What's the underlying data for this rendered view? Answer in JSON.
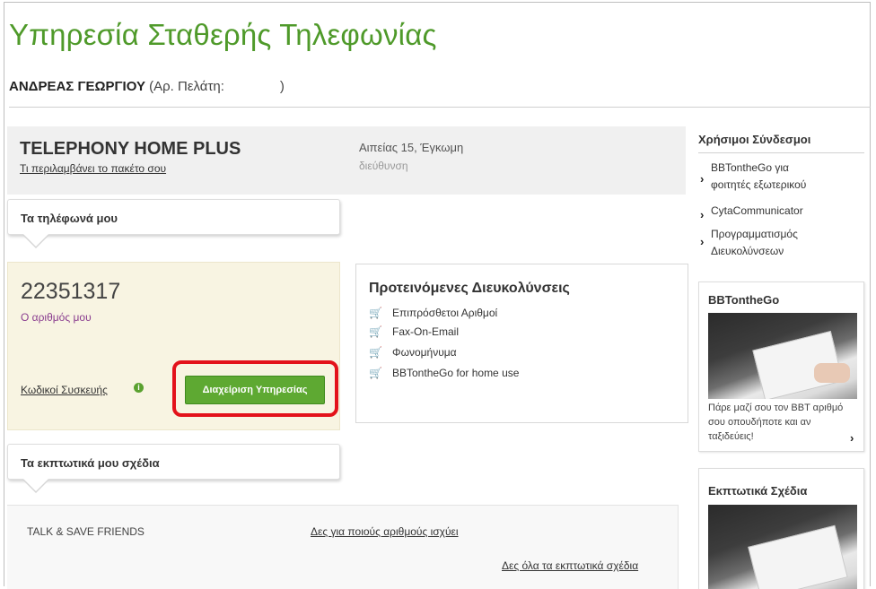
{
  "page": {
    "title": "Υπηρεσία Σταθερής Τηλεφωνίας",
    "customer_name": "ΑΝΔΡΕΑΣ ΓΕΩΡΓΙΟΥ",
    "customer_number_label": "(Αρ. Πελάτη:",
    "customer_number_close": ")"
  },
  "package": {
    "name": "TELEPHONY HOME PLUS",
    "includes_link": "Τι περιλαμβάνει το πακέτο σου",
    "address": "Αιπείας 15, Έγκωμη",
    "address_label": "διεύθυνση"
  },
  "phones": {
    "section_title": "Τα τηλέφωνά μου",
    "number": "22351317",
    "number_label": "Ο αριθμός μου",
    "device_codes_link": "Κωδικοί Συσκευής",
    "manage_button": "Διαχείριση Υπηρεσίας"
  },
  "features": {
    "title": "Προτεινόμενες Διευκολύνσεις",
    "items": [
      "Επιπρόσθετοι Αριθμοί",
      "Fax-On-Email",
      "Φωνομήνυμα",
      "BBTontheGo for home use"
    ]
  },
  "plans": {
    "section_title": "Τα εκπτωτικά μου σχέδια",
    "plan_name": "TALK & SAVE FRIENDS",
    "plan_numbers_link": "Δες για ποιούς αριθμούς ισχύει",
    "all_plans_link": "Δες όλα τα εκπτωτικά σχέδια"
  },
  "sidebar": {
    "useful_links_title": "Χρήσιμοι Σύνδεσμοι",
    "links": [
      {
        "line1": "BBTontheGo για",
        "line2": "φοιτητές εξωτερικού"
      },
      {
        "line1": "CytaCommunicator",
        "line2": ""
      },
      {
        "line1": "Προγραμματισμός",
        "line2": "Διευκολύνσεων"
      }
    ],
    "promo1": {
      "title": "BBTontheGo",
      "text": "Πάρε μαζί σου τον BBT αριθμό σου οπουδήποτε και αν ταξιδεύεις!"
    },
    "promo2": {
      "title": "Εκπτωτικά Σχέδια"
    }
  },
  "icons": {
    "cart": "shopping-cart-icon",
    "chevron": "chevron-right-icon",
    "info": "info-icon"
  },
  "colors": {
    "brand_green": "#4f9a2a",
    "button_green": "#5ea932",
    "highlight_red": "#e3121b",
    "number_label_purple": "#8a3d8f"
  }
}
